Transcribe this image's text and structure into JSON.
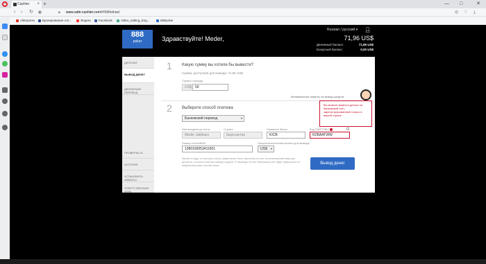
{
  "browser": {
    "tab_title": "Cashier",
    "url_host": "www.safe-cashier.com",
    "url_path": "/#/Withdraw/",
    "new_tab": "+",
    "window_controls": [
      "—",
      "□",
      "✕"
    ]
  },
  "bookmarks": [
    "AliExpress",
    "Бронирование оте...",
    "Яндекс",
    "Facebook",
    "Video_editing_Eng...",
    "888poker"
  ],
  "header": {
    "logo_number": "888",
    "logo_word": "poker",
    "greeting": "Здравствуйте! Meder,",
    "language": "Russian / русский",
    "total": "71,96 US$",
    "cash_label": "Денежный баланс:",
    "cash_value": "71,96 US$",
    "bonus_label": "Бонусный баланс:",
    "bonus_value": "0,00 US$"
  },
  "leftnav": {
    "items": [
      "ДЕПОЗИТ",
      "ВЫВОД ДЕНЕГ",
      "ДЕНЕЖНЫЙ ПЕРЕВОД",
      "ПРОВЕРКА ID",
      "ИСТОРИЯ",
      "УСТАНОВИТЬ ЛИМИТЫ",
      "ОТВЕТСТВЕННАЯ ИГРА"
    ]
  },
  "step1": {
    "number": "1",
    "heading": "Какую сумму вы хотели бы вывести?",
    "available": "Сумма, доступная для вывода: 71,96 US$",
    "amount_label": "Сумма к выводу:",
    "currency": "US$",
    "amount_value": "50"
  },
  "min_note": "Минимальные лимиты на вывод средств",
  "step2": {
    "number": "2",
    "heading": "Выберите способ платежа",
    "method": "Банковский перевод",
    "owner_label": "Имя владельца счета",
    "owner_value": "Meder Jakibaev",
    "country_label": "Страна",
    "country_value": "Кыргызстан",
    "bank_label": "Название банка",
    "bank_value": "KICB",
    "bic_label": "Код SWIFT/BIC",
    "bic_value": "RZBAATWW",
    "account_label": "Номер счета/IBAN",
    "account_value": "1280166053411601",
    "currency_label": "Предпочитительная валюта для вывода",
    "currency_value": "US$"
  },
  "tooltip": "Вы можете вывести деньги на банковский счет, зарегистрированный только в вашей стране",
  "disclaimer": "Имейте в виду, что вся (или часть) суммы может быть зачислена на счет, использованный вами для депозита, согласно политике вывода средств. О переводе на этот банковский счет будет уведомлено по выбранному вами способу связи.",
  "withdraw_button": "Вывод денег"
}
